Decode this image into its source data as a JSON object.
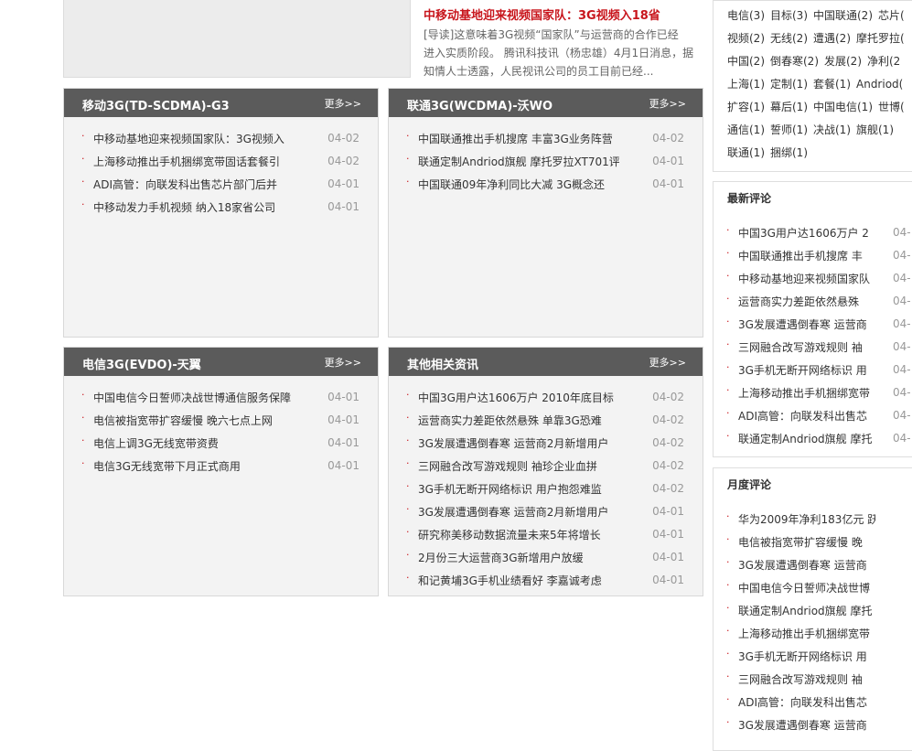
{
  "top_story": {
    "headline": "中移动基地迎来视频国家队：3G视频入18省",
    "lead_lines": [
      "[导读]这意味着3G视频“国家队”与运营商的合作已经",
      "进入实质阶段。 腾讯科技讯（杨忠雄）4月1日消息，据",
      "知情人士透露，人民视讯公司的员工目前已经..."
    ]
  },
  "more_label": "更多>>",
  "panels": [
    {
      "title": "移动3G(TD-SCDMA)-G3",
      "items": [
        {
          "title": "中移动基地迎来视频国家队：3G视频入",
          "date": "04-02"
        },
        {
          "title": "上海移动推出手机捆绑宽带固话套餐引",
          "date": "04-02"
        },
        {
          "title": "ADI高管：向联发科出售芯片部门后并",
          "date": "04-01"
        },
        {
          "title": "中移动发力手机视频 纳入18家省公司",
          "date": "04-01"
        }
      ]
    },
    {
      "title": "联通3G(WCDMA)-沃WO",
      "items": [
        {
          "title": "中国联通推出手机搜席 丰富3G业务阵营",
          "date": "04-02"
        },
        {
          "title": "联通定制Andriod旗舰 摩托罗拉XT701评",
          "date": "04-01"
        },
        {
          "title": "中国联通09年净利同比大减 3G概念还",
          "date": "04-01"
        }
      ]
    },
    {
      "title": "电信3G(EVDO)-天翼",
      "items": [
        {
          "title": "中国电信今日誓师决战世博通信服务保障",
          "date": "04-01"
        },
        {
          "title": "电信被指宽带扩容缓慢 晚六七点上网",
          "date": "04-01"
        },
        {
          "title": "电信上调3G无线宽带资费",
          "date": "04-01"
        },
        {
          "title": "电信3G无线宽带下月正式商用",
          "date": "04-01"
        }
      ]
    },
    {
      "title": "其他相关资讯",
      "items": [
        {
          "title": "中国3G用户达1606万户 2010年底目标",
          "date": "04-02"
        },
        {
          "title": "运营商实力差距依然悬殊 单靠3G恐难",
          "date": "04-02"
        },
        {
          "title": "3G发展遭遇倒春寒 运营商2月新增用户",
          "date": "04-02"
        },
        {
          "title": "三网融合改写游戏规则 袖珍企业血拼",
          "date": "04-02"
        },
        {
          "title": "3G手机无断开网络标识 用户抱怨难监",
          "date": "04-02"
        },
        {
          "title": "3G发展遭遇倒春寒 运营商2月新增用户",
          "date": "04-01"
        },
        {
          "title": "研究称美移动数据流量未来5年将增长",
          "date": "04-01"
        },
        {
          "title": "2月份三大运营商3G新增用户放缓",
          "date": "04-01"
        },
        {
          "title": "和记黄埔3G手机业绩看好 李嘉诚考虑",
          "date": "04-01"
        }
      ]
    }
  ],
  "tag_lines": [
    [
      "电信(3)",
      "目标(3)",
      "中国联通(2)",
      "芯片("
    ],
    [
      "视频(2)",
      "无线(2)",
      "遭遇(2)",
      "摩托罗拉("
    ],
    [
      "中国(2)",
      "倒春寒(2)",
      "发展(2)",
      "净利(2"
    ],
    [
      "上海(1)",
      "定制(1)",
      "套餐(1)",
      "Andriod("
    ],
    [
      "扩容(1)",
      "幕后(1)",
      "中国电信(1)",
      "世博("
    ],
    [
      "通信(1)",
      "誓师(1)",
      "决战(1)",
      "旗舰(1)"
    ],
    [
      "联通(1)",
      "捆绑(1)"
    ]
  ],
  "latest_comments": {
    "title": "最新评论",
    "items": [
      {
        "title": "中国3G用户达1606万户 2",
        "date": "04-"
      },
      {
        "title": "中国联通推出手机搜席 丰",
        "date": "04-"
      },
      {
        "title": "中移动基地迎来视频国家队",
        "date": "04-"
      },
      {
        "title": "运营商实力差距依然悬殊",
        "date": "04-"
      },
      {
        "title": "3G发展遭遇倒春寒 运营商",
        "date": "04-"
      },
      {
        "title": "三网融合改写游戏规则 袖",
        "date": "04-"
      },
      {
        "title": "3G手机无断开网络标识 用",
        "date": "04-"
      },
      {
        "title": "上海移动推出手机捆绑宽带",
        "date": "04-"
      },
      {
        "title": "ADI高管：向联发科出售芯",
        "date": "04-"
      },
      {
        "title": "联通定制Andriod旗舰 摩托",
        "date": "04-"
      }
    ]
  },
  "monthly_comments": {
    "title": "月度评论",
    "items": [
      {
        "title": "华为2009年净利183亿元 跃"
      },
      {
        "title": "电信被指宽带扩容缓慢 晚"
      },
      {
        "title": "3G发展遭遇倒春寒 运营商"
      },
      {
        "title": "中国电信今日誓师决战世博"
      },
      {
        "title": "联通定制Andriod旗舰 摩托"
      },
      {
        "title": "上海移动推出手机捆绑宽带"
      },
      {
        "title": "3G手机无断开网络标识 用"
      },
      {
        "title": "三网融合改写游戏规则 袖"
      },
      {
        "title": "ADI高管：向联发科出售芯"
      },
      {
        "title": "3G发展遭遇倒春寒 运营商"
      }
    ]
  }
}
